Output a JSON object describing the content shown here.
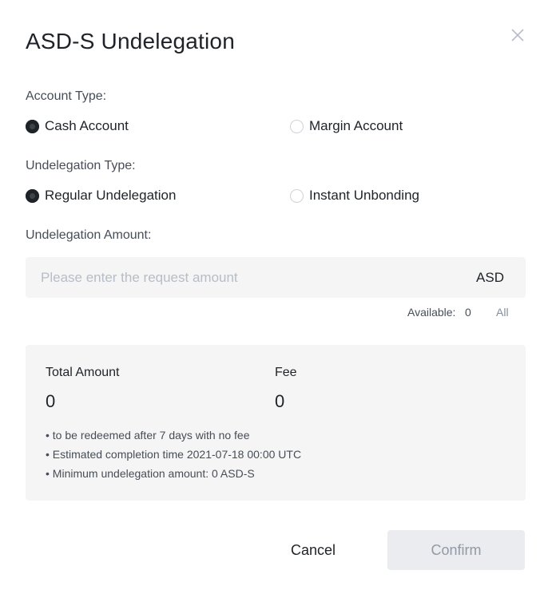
{
  "dialog": {
    "title": "ASD-S Undelegation"
  },
  "account_type": {
    "label": "Account Type:",
    "options": [
      {
        "label": "Cash Account",
        "selected": true
      },
      {
        "label": "Margin Account",
        "selected": false
      }
    ]
  },
  "undelegation_type": {
    "label": "Undelegation Type:",
    "options": [
      {
        "label": "Regular Undelegation",
        "selected": true
      },
      {
        "label": "Instant Unbonding",
        "selected": false
      }
    ]
  },
  "amount": {
    "label": "Undelegation Amount:",
    "placeholder": "Please enter the request amount",
    "value": "",
    "unit": "ASD",
    "available_label": "Available:",
    "available_value": "0",
    "all_label": "All"
  },
  "summary": {
    "total_label": "Total Amount",
    "total_value": "0",
    "fee_label": "Fee",
    "fee_value": "0",
    "notes": [
      "• to be redeemed after 7 days with no fee",
      "• Estimated completion time 2021-07-18 00:00 UTC",
      "• Minimum undelegation amount: 0 ASD-S"
    ]
  },
  "actions": {
    "cancel_label": "Cancel",
    "confirm_label": "Confirm"
  },
  "colors": {
    "text": "#1e2329",
    "panel_bg": "#f5f5f5",
    "disabled_button_bg": "#eaecef",
    "disabled_button_text": "#929aa5"
  },
  "icons": {
    "close": "close-icon"
  }
}
